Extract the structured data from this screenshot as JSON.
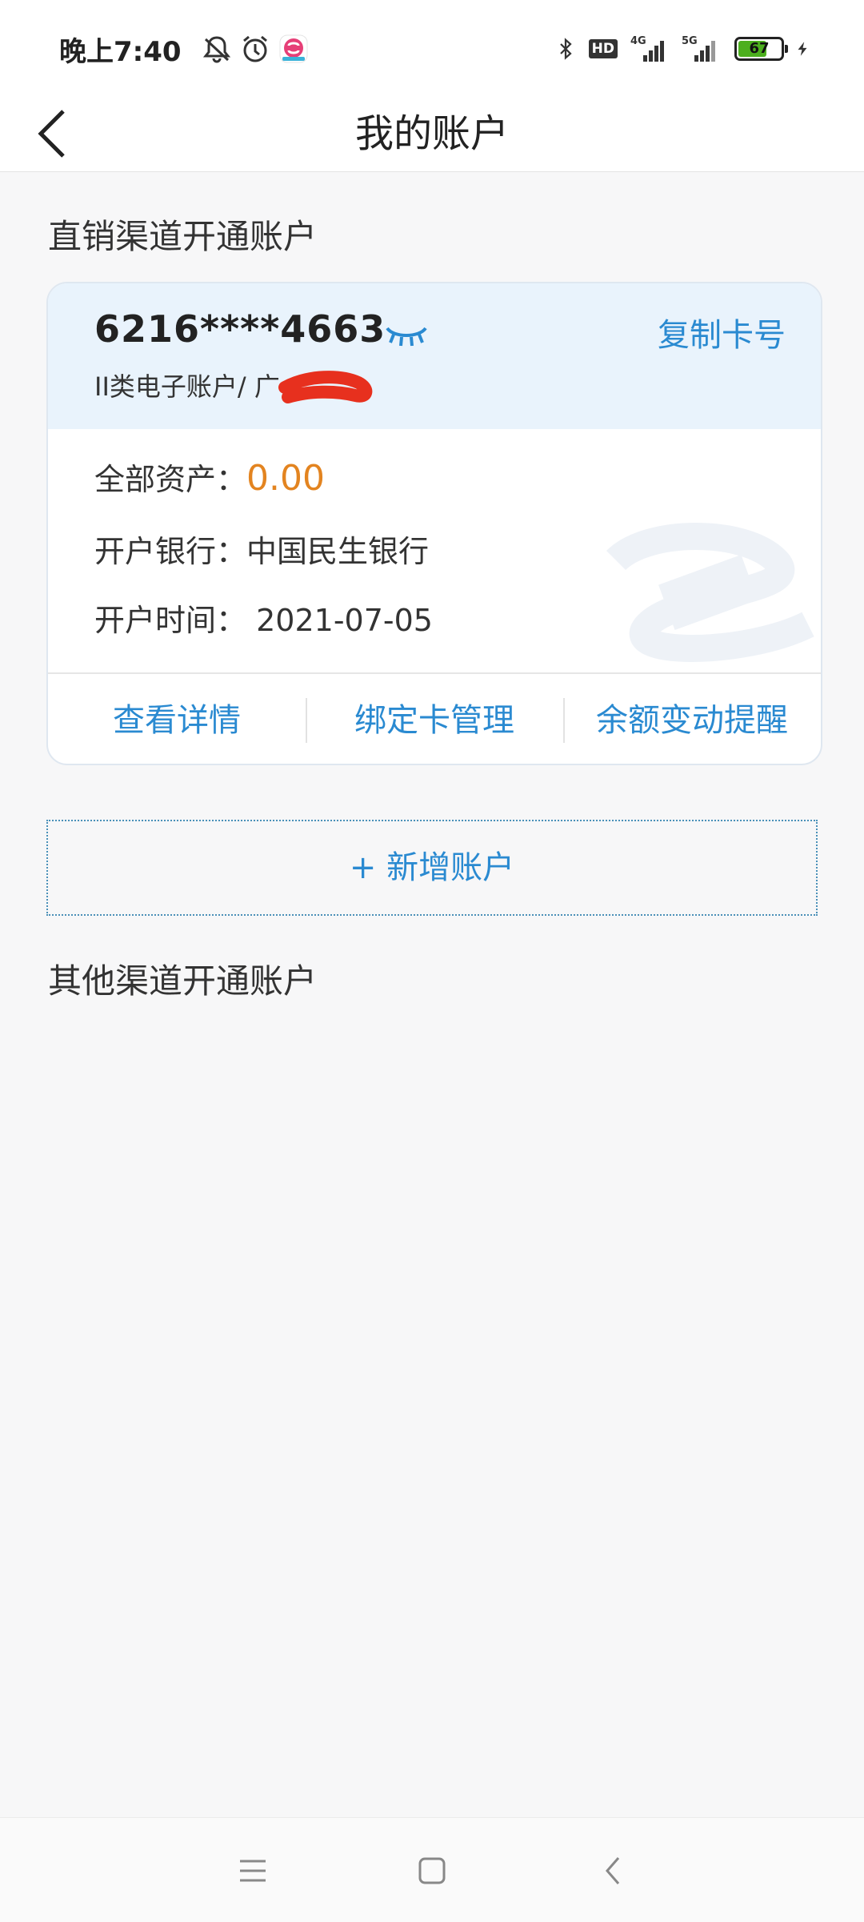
{
  "status_bar": {
    "time": "晚上7:40",
    "hd_label": "HD",
    "net1_label": "4G",
    "net2_label": "5G",
    "battery_level": "67",
    "icons": [
      "notification-off-icon",
      "alarm-clock-icon",
      "app-notification-icon",
      "bluetooth-icon",
      "hd-icon",
      "signal-4g-icon",
      "signal-5g-icon",
      "battery-icon",
      "charging-icon"
    ]
  },
  "nav": {
    "title": "我的账户"
  },
  "direct_section": {
    "title": "直销渠道开通账户"
  },
  "card": {
    "number": "6216****4663",
    "account_type": "II类电子账户/ 广",
    "copy_label": "复制卡号",
    "asset_label": "全部资产：",
    "asset_value": "0.00",
    "bank_label": "开户银行：",
    "bank_value": "中国民生银行",
    "date_label": "开户时间：",
    "date_value": "2021-07-05",
    "actions": {
      "details": "查看详情",
      "bind_card": "绑定卡管理",
      "balance_alert": "余额变动提醒"
    }
  },
  "add_account": {
    "label": "+ 新增账户"
  },
  "other_section": {
    "title": "其他渠道开通账户"
  },
  "colors": {
    "accent": "#2a8ad1",
    "asset_value": "#e38420",
    "card_header_bg": "#e9f3fc",
    "page_bg": "#f7f7f8",
    "battery_green": "#4caf1e"
  }
}
